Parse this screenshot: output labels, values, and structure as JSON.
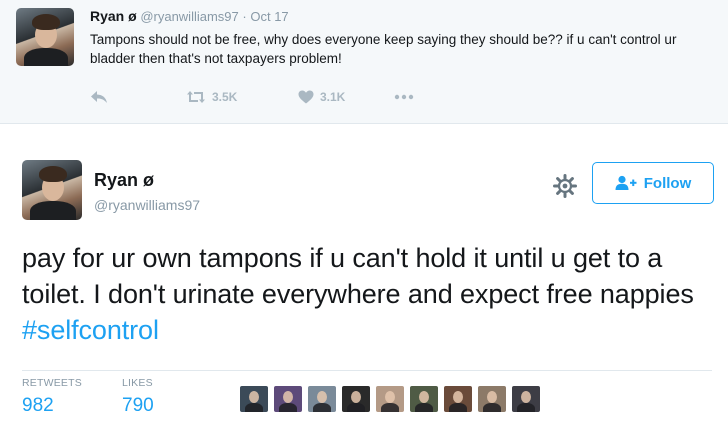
{
  "top_tweet": {
    "name": "Ryan ø",
    "handle": "@ryanwilliams97",
    "separator": "·",
    "date": "Oct 17",
    "text": "Tampons should not be free, why does everyone keep saying they should be?? if u can't control ur bladder then that's not taxpayers problem!",
    "retweet_count": "3.5K",
    "like_count": "3.1K",
    "icons": [
      "reply-icon",
      "retweet-icon",
      "heart-icon",
      "more-icon"
    ]
  },
  "main_tweet": {
    "name": "Ryan ø",
    "handle": "@ryanwilliams97",
    "follow_label": "Follow",
    "text_before": "pay for ur own tampons if u can't hold it until u get to a toilet. I don't urinate everywhere and expect free nappies ",
    "hashtag": "#selfcontrol",
    "retweets_label": "RETWEETS",
    "retweets_value": "982",
    "likes_label": "LIKES",
    "likes_value": "790",
    "icons": [
      "gear-icon",
      "follow-user-icon"
    ]
  },
  "likers": [
    {
      "color": "#3b4a58"
    },
    {
      "color": "#5d4a7a"
    },
    {
      "color": "#7a8a99"
    },
    {
      "color": "#2a2a2a"
    },
    {
      "color": "#b49a86"
    },
    {
      "color": "#4f5b45"
    },
    {
      "color": "#6a4b3a"
    },
    {
      "color": "#8c7a68"
    },
    {
      "color": "#3d3d45"
    }
  ],
  "colors": {
    "accent": "#1da1f2",
    "muted": "#8899a6",
    "icon_gray": "#aab8c2",
    "top_bg": "#f5f8fa"
  }
}
